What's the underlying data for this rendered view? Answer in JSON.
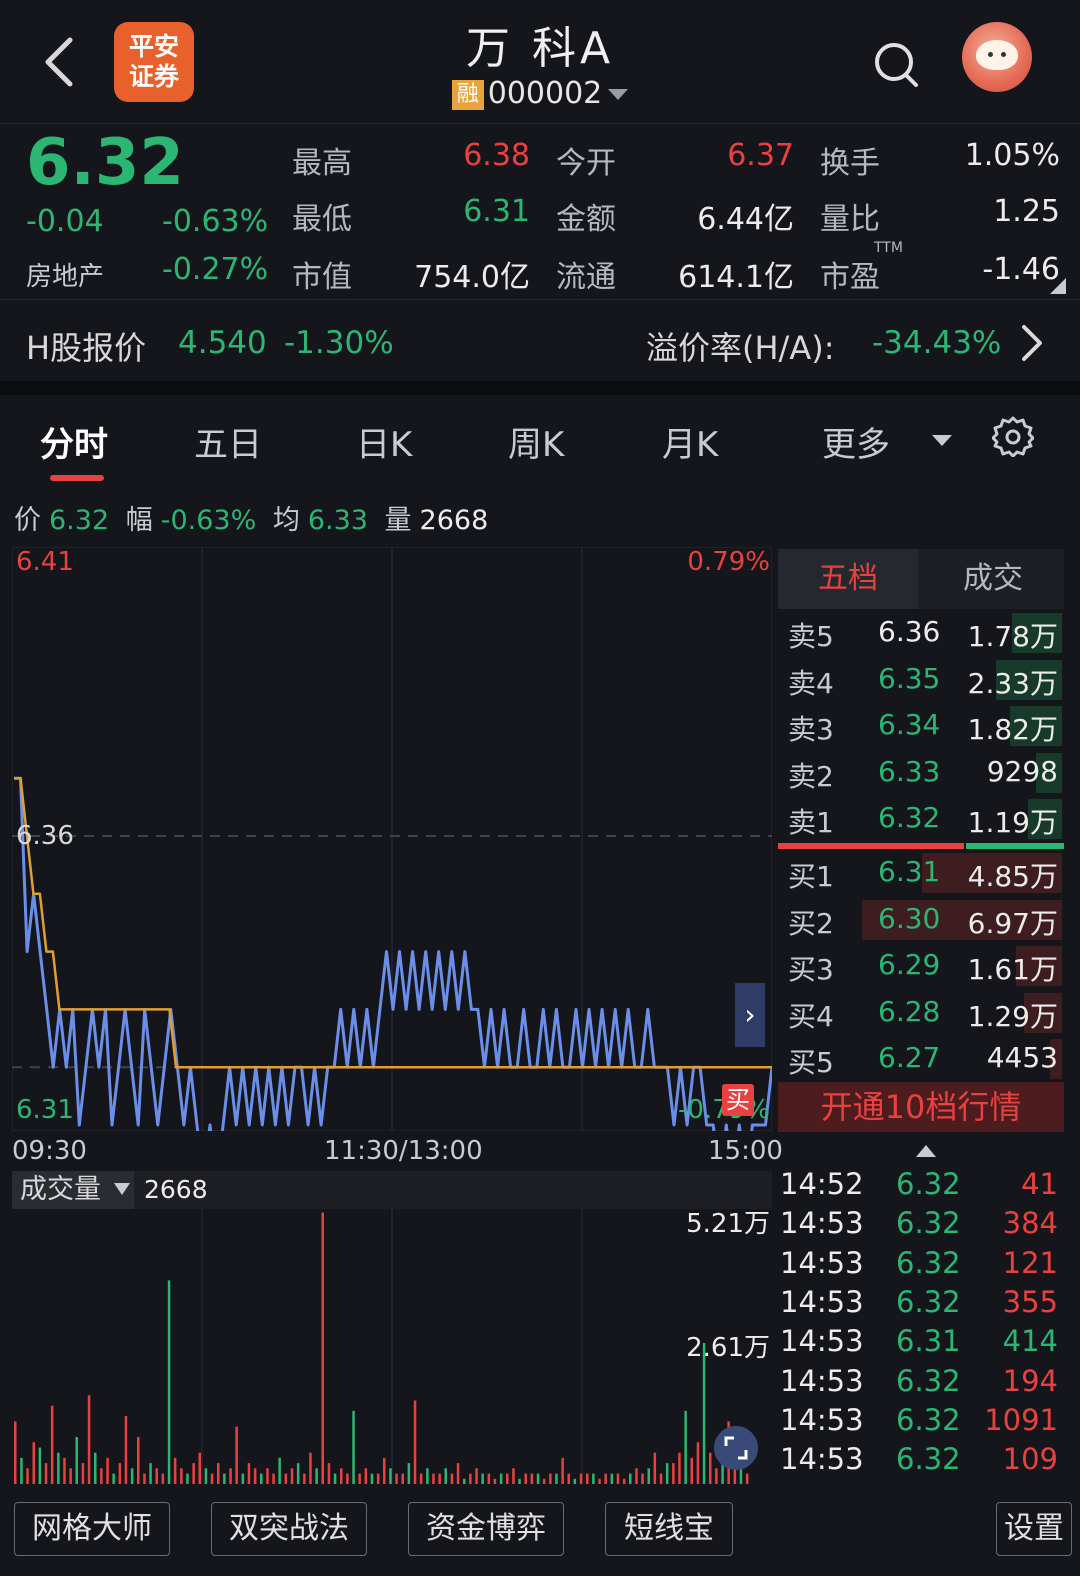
{
  "header": {
    "broker_logo_line1": "平安",
    "broker_logo_line2": "证券",
    "stock_name": "万 科A",
    "margin_badge": "融",
    "stock_code": "000002"
  },
  "quote": {
    "price": "6.32",
    "change": "-0.04",
    "change_pct": "-0.63%",
    "sector": "房地产",
    "sector_pct": "-0.27%",
    "fields": [
      {
        "label": "最高",
        "value": "6.38",
        "color": "#e8413f"
      },
      {
        "label": "今开",
        "value": "6.37",
        "color": "#e8413f"
      },
      {
        "label": "换手",
        "value": "1.05%",
        "color": "#ececec"
      },
      {
        "label": "最低",
        "value": "6.31",
        "color": "#2bb673"
      },
      {
        "label": "金额",
        "value": "6.44亿",
        "color": "#ececec"
      },
      {
        "label": "量比",
        "value": "1.25",
        "color": "#ececec"
      },
      {
        "label": "市值",
        "value": "754.0亿",
        "color": "#ececec"
      },
      {
        "label": "流通",
        "value": "614.1亿",
        "color": "#ececec"
      },
      {
        "label": "市盈",
        "value": "-1.46",
        "color": "#ececec"
      }
    ],
    "pe_superscript": "TTM"
  },
  "hshare": {
    "label": "H股报价",
    "price": "4.540",
    "pct": "-1.30%",
    "premium_label": "溢价率(H/A):",
    "premium_value": "-34.43%"
  },
  "tabs": [
    "分时",
    "五日",
    "日K",
    "周K",
    "月K",
    "更多"
  ],
  "infoline": {
    "price_label": "价",
    "price": "6.32",
    "pct_label": "幅",
    "pct": "-0.63%",
    "avg_label": "均",
    "avg": "6.33",
    "vol_label": "量",
    "vol": "2668"
  },
  "chart": {
    "y_max_label": "6.41",
    "y_max_pct": "0.79%",
    "y_mid_label": "6.36",
    "y_min_label": "6.31",
    "y_min_pct": "-0.79%",
    "buy_marker": "买",
    "time_labels": [
      "09:30",
      "11:30/13:00",
      "15:00"
    ]
  },
  "chart_data": {
    "type": "line",
    "title": "",
    "ylim": [
      6.31,
      6.41
    ],
    "prev_close": 6.36,
    "series": [
      {
        "name": "价",
        "color": "#6b8fe8",
        "values": [
          6.37,
          6.37,
          6.34,
          6.35,
          6.34,
          6.33,
          6.32,
          6.33,
          6.32,
          6.33,
          6.31,
          6.32,
          6.33,
          6.32,
          6.33,
          6.31,
          6.32,
          6.33,
          6.32,
          6.31,
          6.33,
          6.32,
          6.31,
          6.32,
          6.33,
          6.32,
          6.31,
          6.32,
          6.31,
          6.3,
          6.31,
          6.3,
          6.31,
          6.32,
          6.31,
          6.32,
          6.31,
          6.32,
          6.31,
          6.32,
          6.31,
          6.32,
          6.31,
          6.32,
          6.32,
          6.31,
          6.32,
          6.31,
          6.32,
          6.32,
          6.33,
          6.32,
          6.33,
          6.32,
          6.33,
          6.32,
          6.33,
          6.34,
          6.33,
          6.34,
          6.33,
          6.34,
          6.33,
          6.34,
          6.33,
          6.34,
          6.33,
          6.34,
          6.33,
          6.34,
          6.33,
          6.33,
          6.32,
          6.33,
          6.32,
          6.33,
          6.32,
          6.32,
          6.33,
          6.32,
          6.32,
          6.33,
          6.32,
          6.33,
          6.32,
          6.32,
          6.33,
          6.32,
          6.33,
          6.32,
          6.33,
          6.32,
          6.33,
          6.32,
          6.33,
          6.32,
          6.32,
          6.33,
          6.32,
          6.32,
          6.32,
          6.31,
          6.32,
          6.31,
          6.32,
          6.32,
          6.31,
          6.31,
          6.3,
          6.31,
          6.3,
          6.31,
          6.3,
          6.31,
          6.31,
          6.31,
          6.32
        ]
      },
      {
        "name": "均",
        "color": "#e0a030",
        "values": [
          6.37,
          6.37,
          6.36,
          6.35,
          6.35,
          6.34,
          6.34,
          6.33,
          6.33,
          6.33,
          6.33,
          6.33,
          6.33,
          6.33,
          6.33,
          6.33,
          6.33,
          6.33,
          6.33,
          6.33,
          6.33,
          6.33,
          6.33,
          6.33,
          6.33,
          6.32,
          6.32,
          6.32,
          6.32,
          6.32,
          6.32,
          6.32,
          6.32,
          6.32,
          6.32,
          6.32,
          6.32,
          6.32,
          6.32,
          6.32,
          6.32,
          6.32,
          6.32,
          6.32,
          6.32,
          6.32,
          6.32,
          6.32,
          6.32,
          6.32,
          6.32,
          6.32,
          6.32,
          6.32,
          6.32,
          6.32,
          6.32,
          6.32,
          6.32,
          6.32,
          6.32,
          6.32,
          6.32,
          6.32,
          6.32,
          6.32,
          6.32,
          6.32,
          6.32,
          6.32,
          6.32,
          6.32,
          6.32,
          6.32,
          6.32,
          6.32,
          6.32,
          6.32,
          6.32,
          6.32,
          6.32,
          6.32,
          6.32,
          6.32,
          6.32,
          6.32,
          6.32,
          6.32,
          6.32,
          6.32,
          6.32,
          6.32,
          6.32,
          6.32,
          6.32,
          6.32,
          6.32,
          6.32,
          6.32,
          6.32,
          6.32,
          6.32,
          6.32,
          6.32,
          6.32,
          6.32,
          6.32,
          6.32,
          6.32,
          6.32,
          6.32,
          6.32,
          6.32,
          6.32,
          6.32,
          6.32,
          6.32,
          6.32
        ]
      }
    ]
  },
  "volume": {
    "selector": "成交量",
    "value": "2668",
    "max_label": "5.21万",
    "mid_label": "2.61万",
    "ylim": [
      0,
      52100
    ],
    "bars": [
      12000,
      5000,
      3000,
      8000,
      7000,
      4000,
      15000,
      6000,
      5000,
      3000,
      9000,
      4000,
      17000,
      6000,
      3000,
      5000,
      2000,
      4000,
      13000,
      3000,
      9000,
      2000,
      4000,
      3000,
      2000,
      39000,
      5000,
      3000,
      2000,
      4000,
      6000,
      3000,
      2000,
      4000,
      2000,
      3000,
      11000,
      2000,
      4000,
      3000,
      2000,
      3000,
      2000,
      5000,
      2000,
      3000,
      4000,
      2000,
      6000,
      3000,
      52000,
      4000,
      2000,
      3000,
      2000,
      14000,
      2000,
      3000,
      2000,
      2000,
      5000,
      3000,
      2000,
      2000,
      4000,
      16000,
      2000,
      3000,
      2000,
      2000,
      3000,
      2000,
      4000,
      1000,
      2000,
      3000,
      2000,
      2000,
      1000,
      2000,
      2000,
      3000,
      1000,
      2000,
      2000,
      2000,
      1000,
      2000,
      2000,
      5000,
      2000,
      1000,
      2000,
      2000,
      2000,
      1000,
      2000,
      2000,
      2000,
      1000,
      2000,
      3000,
      2000,
      3000,
      6000,
      2000,
      4000,
      4000,
      6000,
      14000,
      5000,
      8000,
      27000,
      6000,
      3000,
      5000,
      12000,
      3000,
      4000,
      2000
    ],
    "bar_colors": "mixed"
  },
  "order_book": {
    "tab_five": "五档",
    "tab_trades": "成交",
    "asks": [
      {
        "label": "卖5",
        "price": "6.36",
        "vol": "1.78万",
        "color": "#ececec",
        "bar": 0.25
      },
      {
        "label": "卖4",
        "price": "6.35",
        "vol": "2.33万",
        "color": "#2bb673",
        "bar": 0.33
      },
      {
        "label": "卖3",
        "price": "6.34",
        "vol": "1.82万",
        "color": "#2bb673",
        "bar": 0.26
      },
      {
        "label": "卖2",
        "price": "6.33",
        "vol": "9298",
        "color": "#2bb673",
        "bar": 0.13
      },
      {
        "label": "卖1",
        "price": "6.32",
        "vol": "1.19万",
        "color": "#2bb673",
        "bar": 0.17
      }
    ],
    "bids": [
      {
        "label": "买1",
        "price": "6.31",
        "vol": "4.85万",
        "color": "#2bb673",
        "bar": 0.7
      },
      {
        "label": "买2",
        "price": "6.30",
        "vol": "6.97万",
        "color": "#2bb673",
        "bar": 1.0
      },
      {
        "label": "买3",
        "price": "6.29",
        "vol": "1.61万",
        "color": "#2bb673",
        "bar": 0.23
      },
      {
        "label": "买4",
        "price": "6.28",
        "vol": "1.29万",
        "color": "#2bb673",
        "bar": 0.19
      },
      {
        "label": "买5",
        "price": "6.27",
        "vol": "4453",
        "color": "#2bb673",
        "bar": 0.06
      }
    ],
    "upgrade": "开通10档行情"
  },
  "trades": [
    {
      "time": "14:52",
      "price": "6.32",
      "vol": "41",
      "pcolor": "#2bb673",
      "vcolor": "#e8413f"
    },
    {
      "time": "14:53",
      "price": "6.32",
      "vol": "384",
      "pcolor": "#2bb673",
      "vcolor": "#e8413f"
    },
    {
      "time": "14:53",
      "price": "6.32",
      "vol": "121",
      "pcolor": "#2bb673",
      "vcolor": "#e8413f"
    },
    {
      "time": "14:53",
      "price": "6.32",
      "vol": "355",
      "pcolor": "#2bb673",
      "vcolor": "#e8413f"
    },
    {
      "time": "14:53",
      "price": "6.31",
      "vol": "414",
      "pcolor": "#2bb673",
      "vcolor": "#2bb673"
    },
    {
      "time": "14:53",
      "price": "6.32",
      "vol": "194",
      "pcolor": "#2bb673",
      "vcolor": "#e8413f"
    },
    {
      "time": "14:53",
      "price": "6.32",
      "vol": "1091",
      "pcolor": "#2bb673",
      "vcolor": "#e8413f"
    },
    {
      "time": "14:53",
      "price": "6.32",
      "vol": "109",
      "pcolor": "#2bb673",
      "vcolor": "#e8413f"
    }
  ],
  "bottom": {
    "tools": [
      "网格大师",
      "双突战法",
      "资金博弈",
      "短线宝"
    ],
    "settings": "设置"
  },
  "colors": {
    "up": "#e8413f",
    "down": "#2bb673",
    "price_line": "#6b8fe8",
    "avg_line": "#e0a030"
  }
}
